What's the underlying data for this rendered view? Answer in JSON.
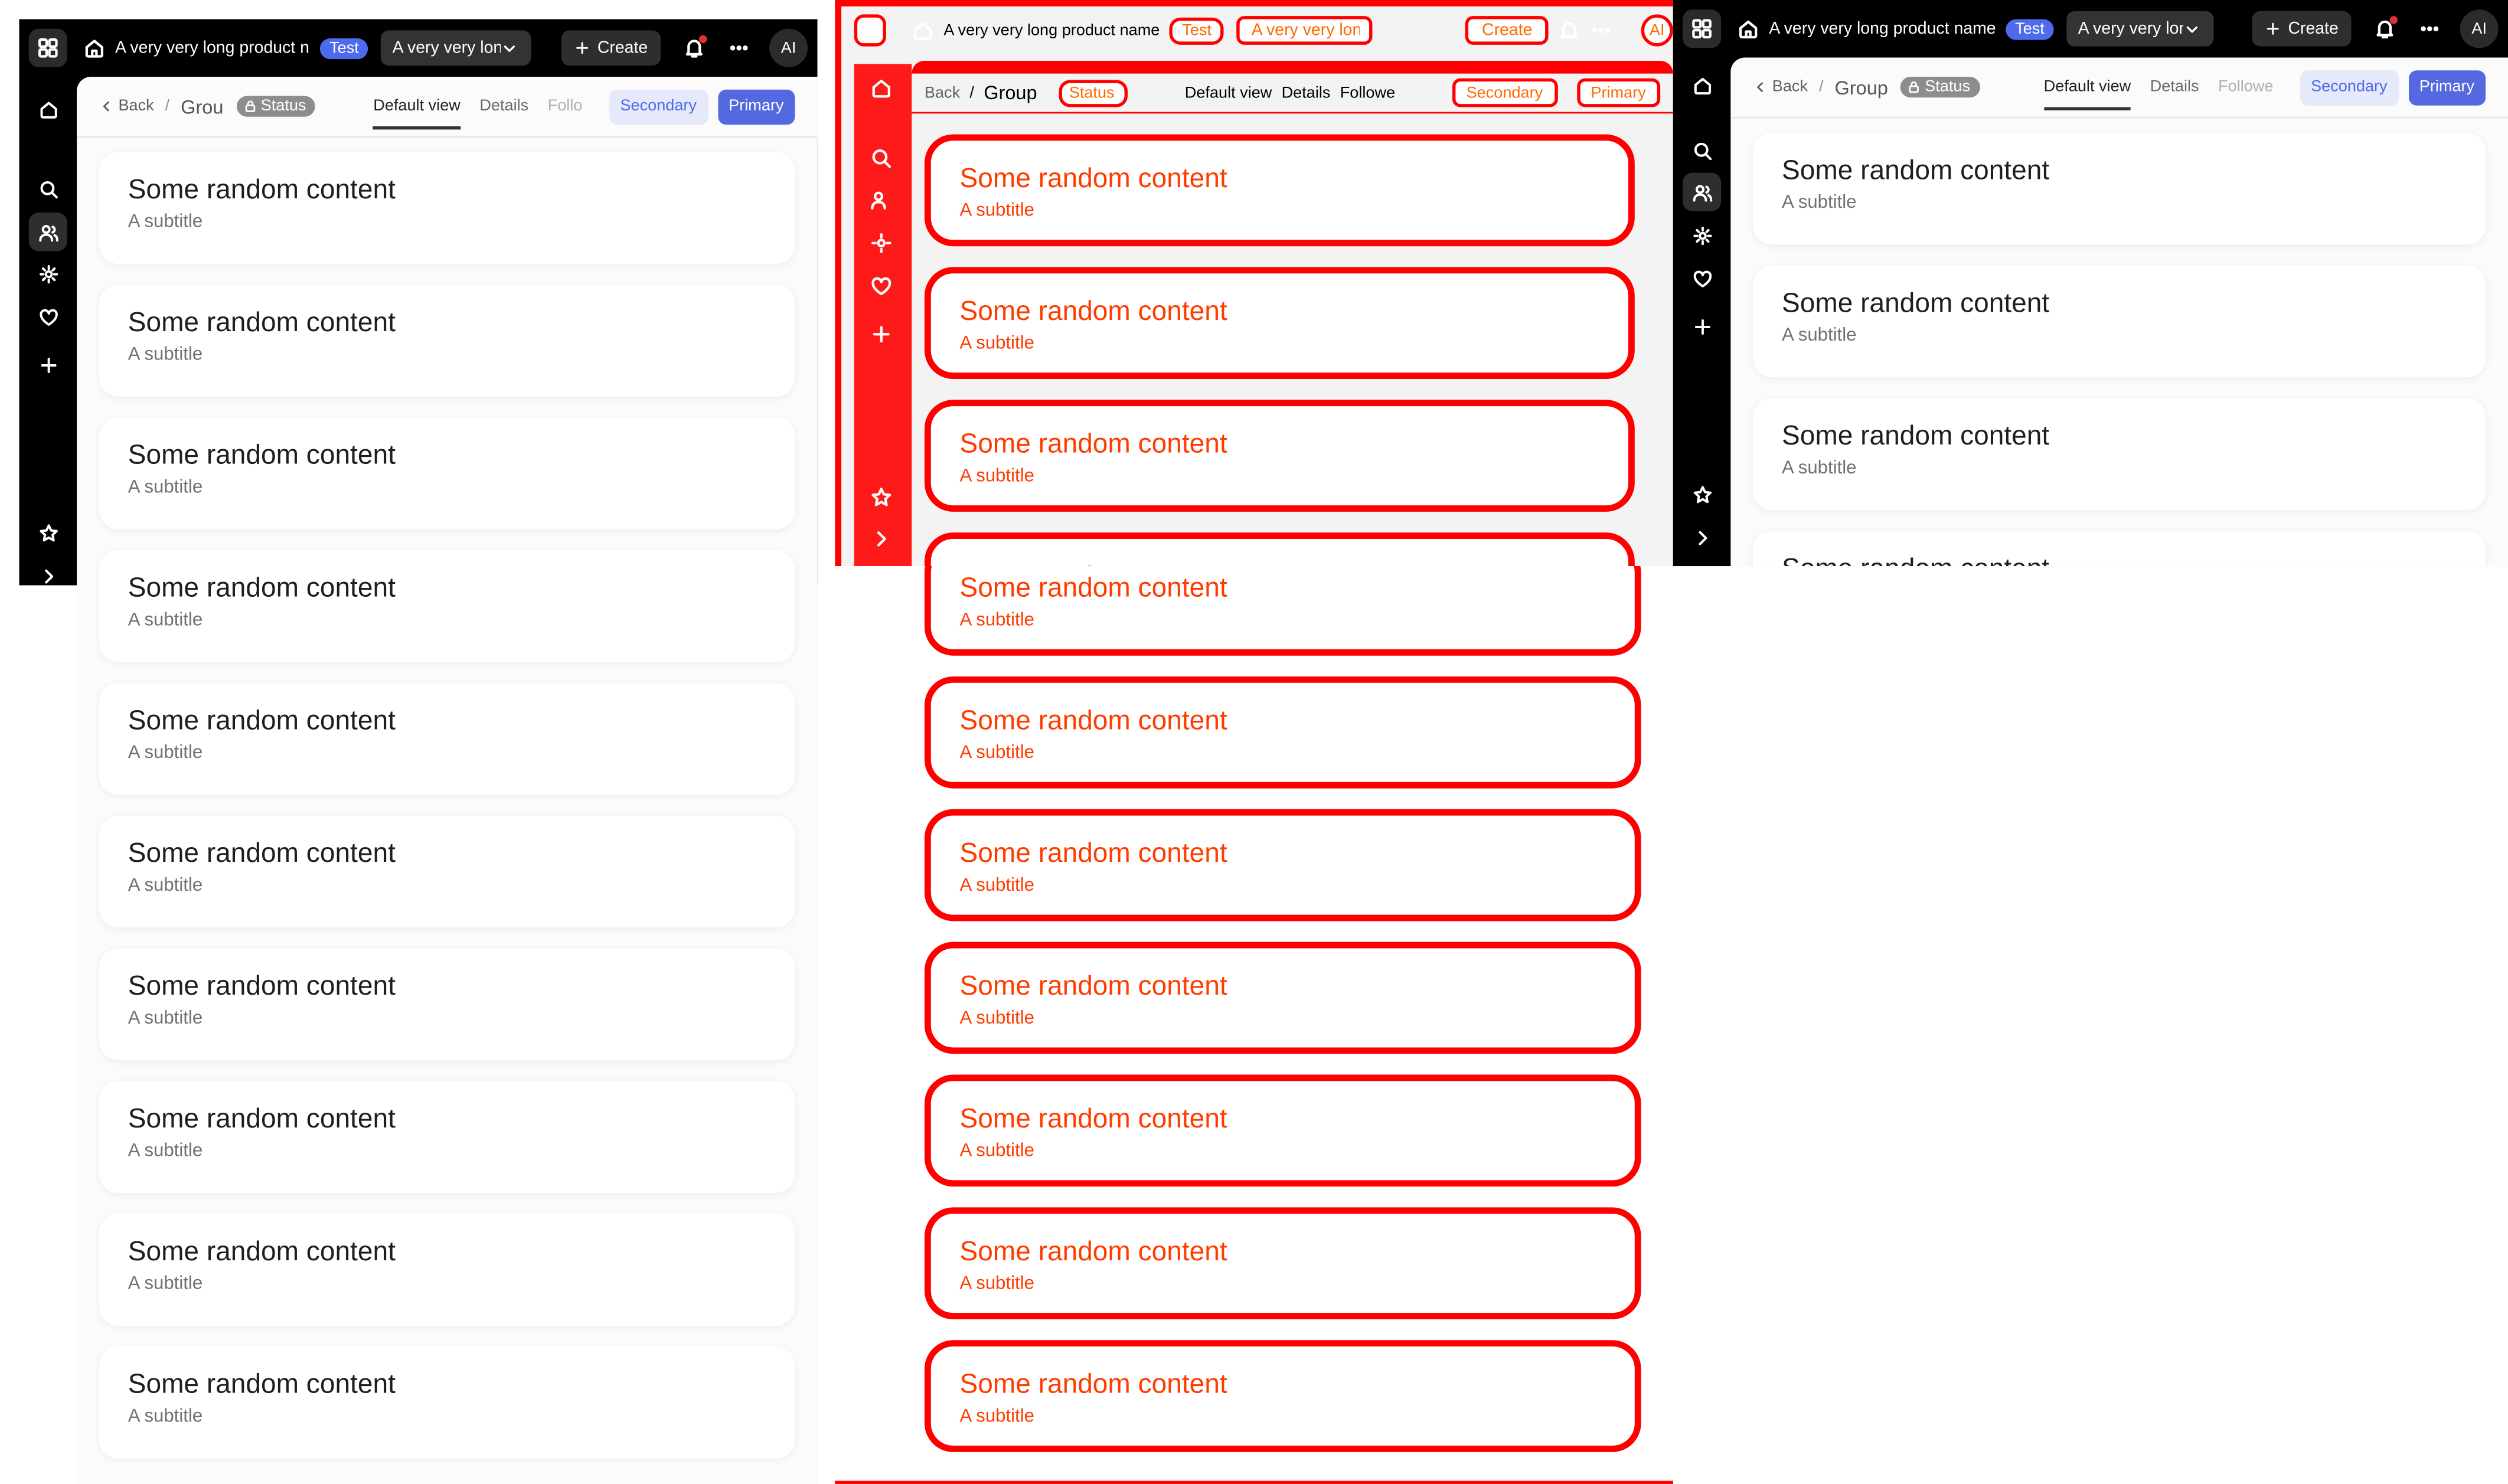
{
  "topbar": {
    "product_name": "A very very long product name",
    "product_name_truncated": "A very very long product n",
    "tag": "Test",
    "select_value": "A very very long",
    "select_value_short": "A very very lon",
    "create_label": "Create",
    "avatar_initials": "AI"
  },
  "header": {
    "back_label": "Back",
    "separator": "/",
    "group_label": "Group",
    "group_label_short": "Grou",
    "status_label": "Status",
    "tabs": [
      {
        "label": "Default view"
      },
      {
        "label": "Details"
      },
      {
        "label": "Followers"
      }
    ],
    "tab_followers_short": "Follo",
    "tab_followers_mid": "Followe",
    "secondary_label": "Secondary",
    "primary_label": "Primary"
  },
  "card": {
    "title": "Some random content",
    "subtitle": "A subtitle"
  },
  "colors": {
    "accent": "#4f6bed",
    "debug_outline": "#ff0000"
  },
  "icons": [
    "apps-grid-icon",
    "home-icon",
    "search-icon",
    "users-icon",
    "gear-icon",
    "heart-icon",
    "plus-icon",
    "star-icon",
    "chevron-right-icon",
    "bell-icon",
    "more-icon",
    "chevron-down-icon",
    "chevron-left-icon",
    "lock-icon"
  ]
}
